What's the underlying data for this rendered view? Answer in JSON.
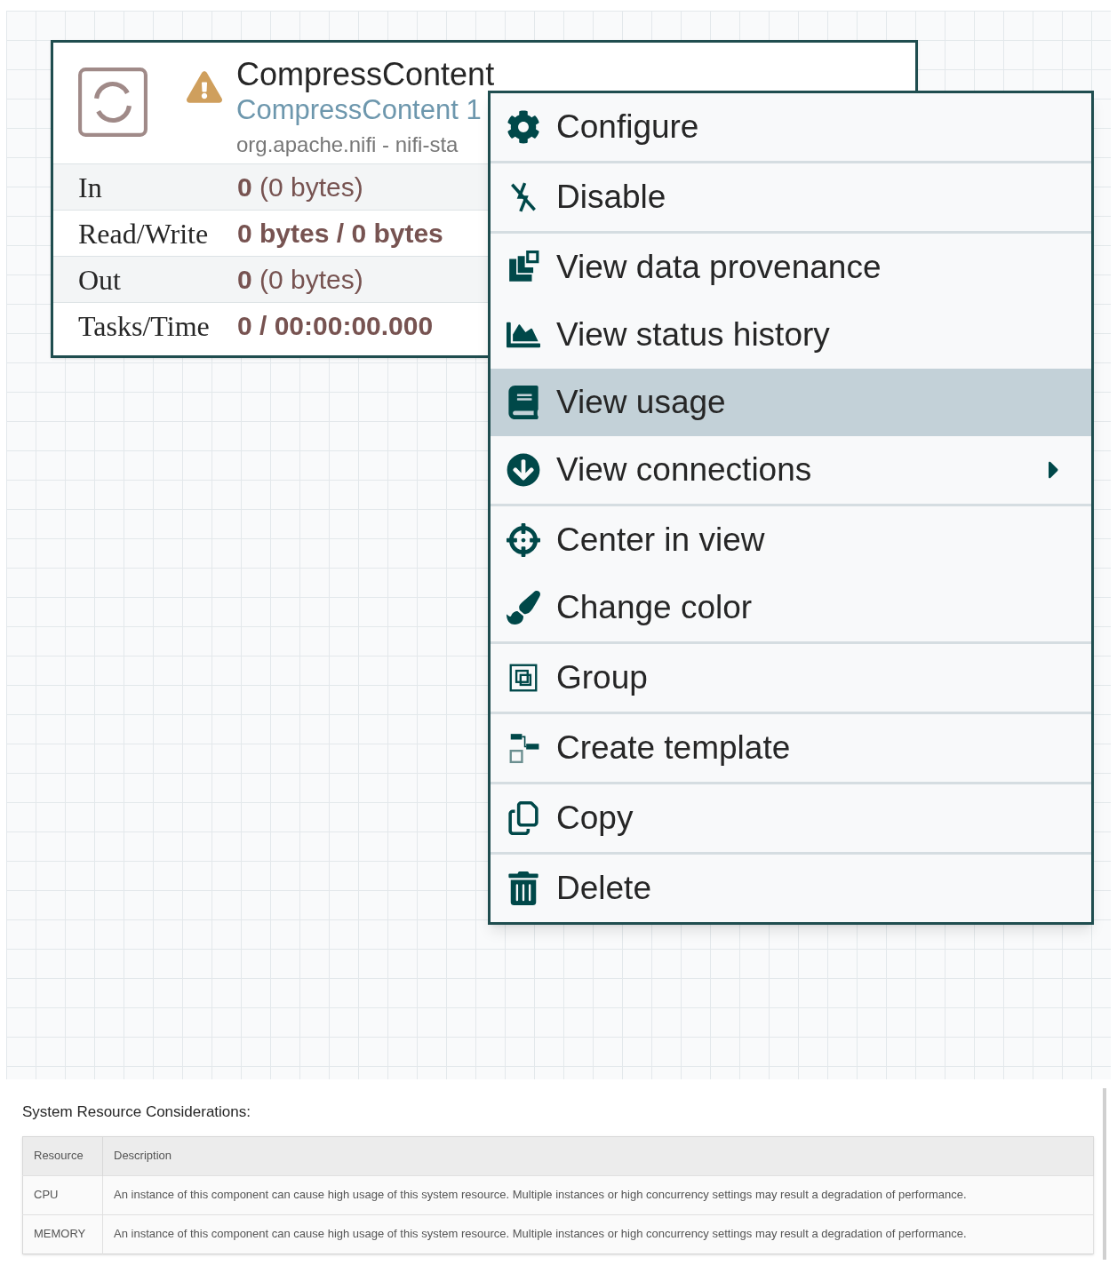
{
  "processor": {
    "name": "CompressContent",
    "type": "CompressContent 1",
    "bundle": "org.apache.nifi - nifi-sta",
    "stats": [
      {
        "label": "In",
        "value": "**0** (0 bytes)",
        "bold": false
      },
      {
        "label": "Read/Write",
        "value": "0 bytes / 0 bytes",
        "bold": true
      },
      {
        "label": "Out",
        "value": "**0** (0 bytes)",
        "bold": false
      },
      {
        "label": "Tasks/Time",
        "value": "0 / 00:00:00.000",
        "bold": true
      }
    ]
  },
  "context_menu": {
    "groups": [
      [
        {
          "label": "Configure",
          "selected": false,
          "submenu": false
        }
      ],
      [
        {
          "label": "Disable",
          "selected": false,
          "submenu": false
        }
      ],
      [
        {
          "label": "View data provenance",
          "selected": false,
          "submenu": false
        },
        {
          "label": "View status history",
          "selected": false,
          "submenu": false
        },
        {
          "label": "View usage",
          "selected": true,
          "submenu": false
        },
        {
          "label": "View connections",
          "selected": false,
          "submenu": true
        }
      ],
      [
        {
          "label": "Center in view",
          "selected": false,
          "submenu": false
        },
        {
          "label": "Change color",
          "selected": false,
          "submenu": false
        }
      ],
      [
        {
          "label": "Group",
          "selected": false,
          "submenu": false
        }
      ],
      [
        {
          "label": "Create template",
          "selected": false,
          "submenu": false
        }
      ],
      [
        {
          "label": "Copy",
          "selected": false,
          "submenu": false
        }
      ],
      [
        {
          "label": "Delete",
          "selected": false,
          "submenu": false
        }
      ]
    ]
  },
  "resources": {
    "title": "System Resource Considerations:",
    "columns": [
      "Resource",
      "Description"
    ],
    "rows": [
      [
        "CPU",
        "An instance of this component can cause high usage of this system resource. Multiple instances or high concurrency settings may result a degradation of performance."
      ],
      [
        "MEMORY",
        "An instance of this component can cause high usage of this system resource. Multiple instances or high concurrency settings may result a degradation of performance."
      ]
    ]
  }
}
